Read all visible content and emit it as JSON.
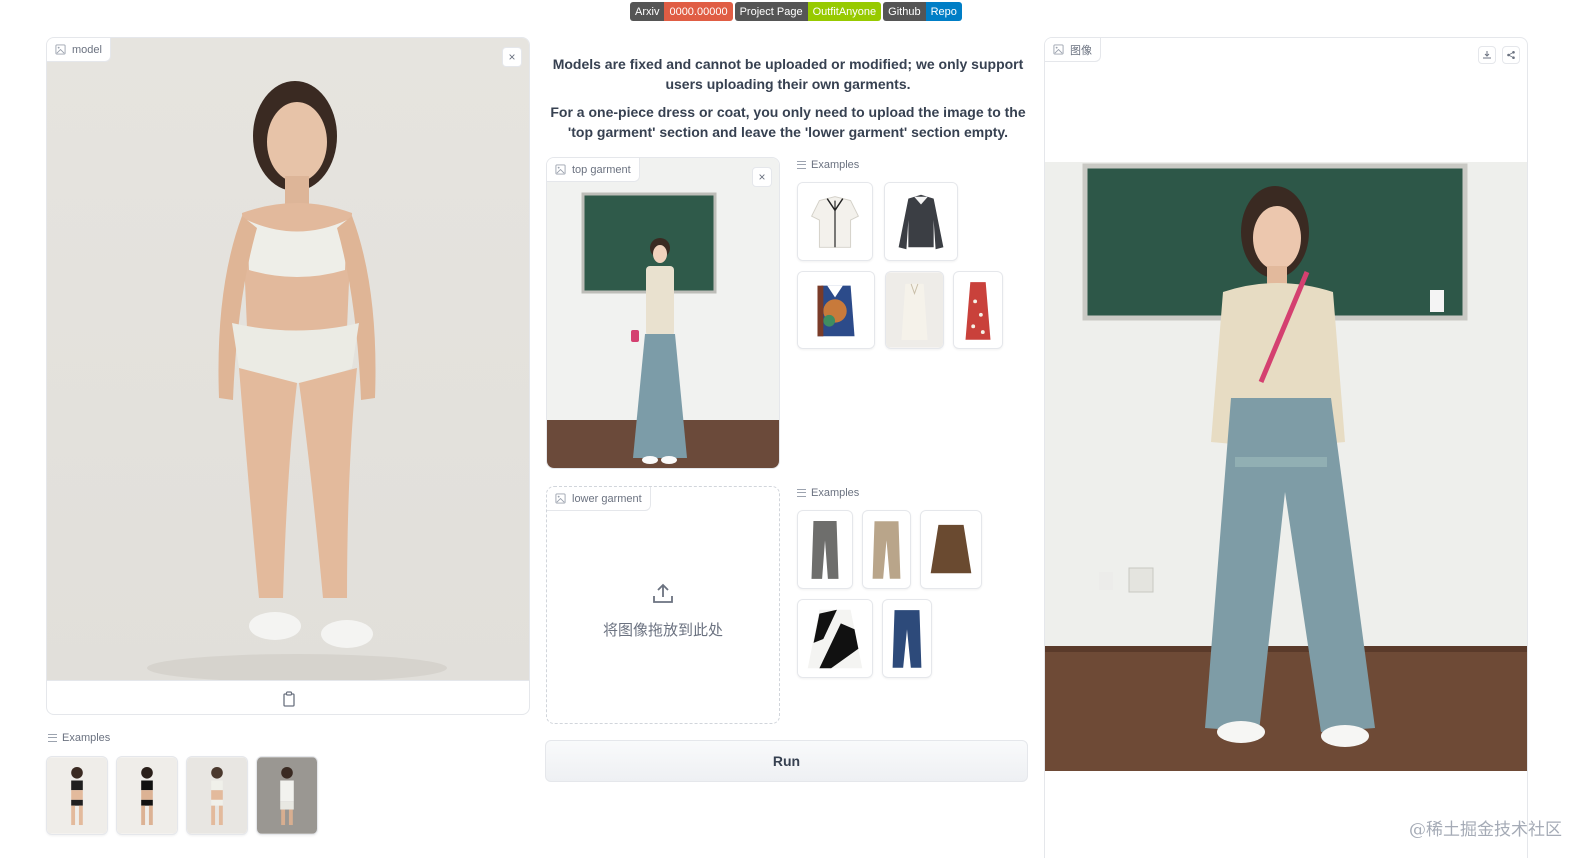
{
  "badges": [
    {
      "left": "Arxiv",
      "right": "0000.00000",
      "color": "#e05d44"
    },
    {
      "left": "Project Page",
      "right": "OutfitAnyone",
      "color": "#97ca00"
    },
    {
      "left": "Github",
      "right": "Repo",
      "color": "#007ec6"
    }
  ],
  "model_panel": {
    "label": "model",
    "close": "×"
  },
  "model_examples": {
    "label": "Examples"
  },
  "info": {
    "line1": "Models are fixed and cannot be uploaded or modified; we only support users uploading their own garments.",
    "line2": "For a one-piece dress or coat, you only need to upload the image to the 'top garment' section and leave the 'lower garment' section empty."
  },
  "top_garment": {
    "label": "top garment",
    "close": "×"
  },
  "top_examples": {
    "label": "Examples"
  },
  "lower_garment": {
    "label": "lower garment",
    "drop_text": "将图像拖放到此处"
  },
  "lower_examples": {
    "label": "Examples"
  },
  "run_button": {
    "label": "Run"
  },
  "output": {
    "label": "图像"
  },
  "watermark": "@稀土掘金技术社区",
  "icons": {
    "image": "image-icon",
    "close": "close-icon",
    "clipboard": "clipboard-icon",
    "upload": "upload-icon",
    "download": "download-icon",
    "share": "share-icon"
  }
}
